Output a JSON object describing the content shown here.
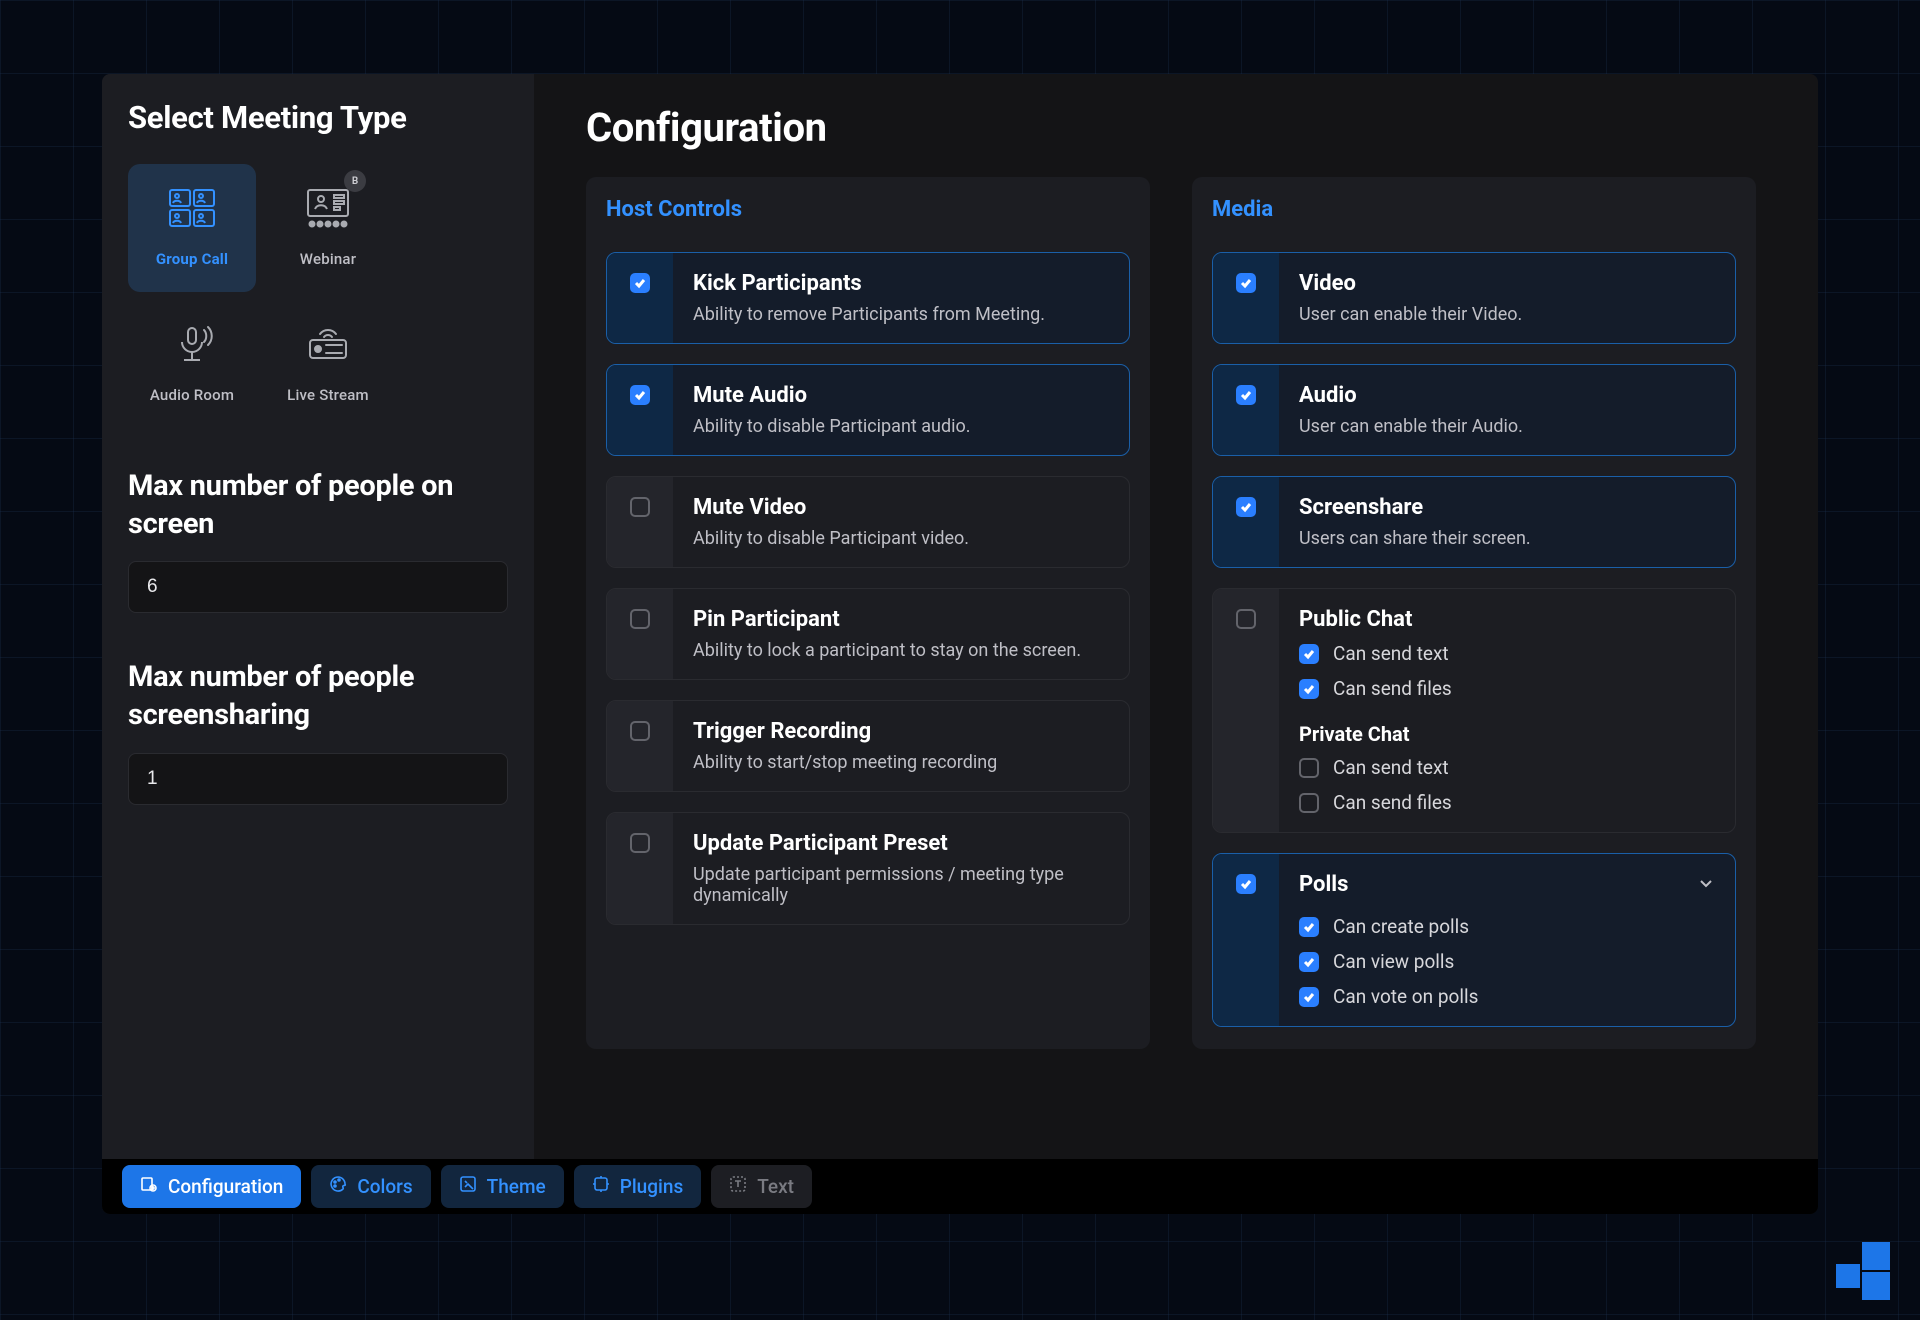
{
  "sidebar": {
    "title": "Select Meeting Type",
    "types": [
      {
        "id": "group-call",
        "label": "Group Call",
        "active": true
      },
      {
        "id": "webinar",
        "label": "Webinar",
        "badge": "B"
      },
      {
        "id": "audio-room",
        "label": "Audio Room"
      },
      {
        "id": "live-stream",
        "label": "Live Stream"
      }
    ],
    "max_people_label": "Max number of people on screen",
    "max_people_value": "6",
    "max_screenshare_label": "Max number of people screensharing",
    "max_screenshare_value": "1"
  },
  "main": {
    "title": "Configuration",
    "host_controls": {
      "title": "Host Controls",
      "items": [
        {
          "checked": true,
          "title": "Kick Participants",
          "desc": "Ability to remove Participants from Meeting."
        },
        {
          "checked": true,
          "title": "Mute Audio",
          "desc": "Ability to disable Participant audio."
        },
        {
          "checked": false,
          "title": "Mute Video",
          "desc": "Ability to disable Participant video."
        },
        {
          "checked": false,
          "title": "Pin Participant",
          "desc": "Ability to lock a participant to stay on the screen."
        },
        {
          "checked": false,
          "title": "Trigger Recording",
          "desc": "Ability to start/stop meeting recording"
        },
        {
          "checked": false,
          "title": "Update Participant Preset",
          "desc": "Update participant permissions / meeting type dynamically"
        }
      ]
    },
    "media": {
      "title": "Media",
      "items": [
        {
          "checked": true,
          "title": "Video",
          "desc": "User can enable their Video."
        },
        {
          "checked": true,
          "title": "Audio",
          "desc": "User can enable their Audio."
        },
        {
          "checked": true,
          "title": "Screenshare",
          "desc": "Users can share their screen."
        }
      ],
      "chat": {
        "master_checked": false,
        "public_label": "Public Chat",
        "public_items": [
          {
            "checked": true,
            "label": "Can send text"
          },
          {
            "checked": true,
            "label": "Can send files"
          }
        ],
        "private_label": "Private Chat",
        "private_items": [
          {
            "checked": false,
            "label": "Can send text"
          },
          {
            "checked": false,
            "label": "Can send files"
          }
        ]
      },
      "polls": {
        "master_checked": true,
        "title": "Polls",
        "items": [
          {
            "checked": true,
            "label": "Can create polls"
          },
          {
            "checked": true,
            "label": "Can view polls"
          },
          {
            "checked": true,
            "label": "Can vote on polls"
          }
        ]
      }
    }
  },
  "tabs": [
    {
      "id": "configuration",
      "label": "Configuration",
      "active": true
    },
    {
      "id": "colors",
      "label": "Colors"
    },
    {
      "id": "theme",
      "label": "Theme"
    },
    {
      "id": "plugins",
      "label": "Plugins"
    },
    {
      "id": "text",
      "label": "Text",
      "muted": true
    }
  ],
  "colors": {
    "accent": "#2a7fff",
    "bg_dark": "#141416",
    "panel": "#1c1d22",
    "checked_border": "#1a5fa8"
  }
}
